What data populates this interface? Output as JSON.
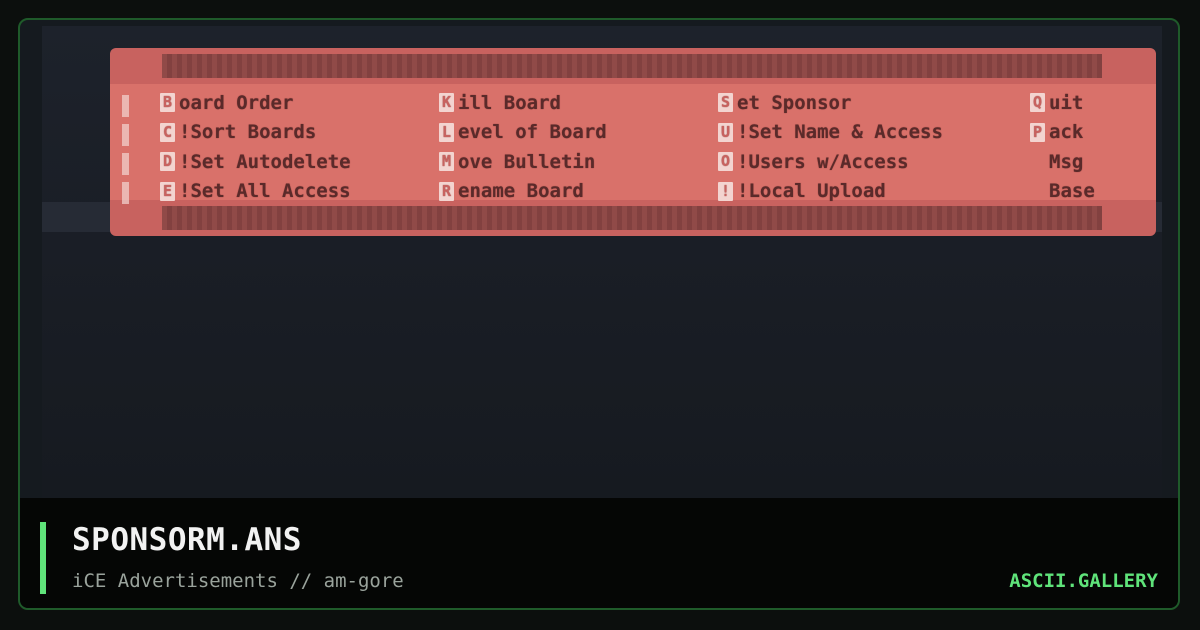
{
  "art": {
    "menu": {
      "columns": [
        {
          "items": [
            {
              "key": "B",
              "label": "oard Order"
            },
            {
              "key": "C",
              "label": "!Sort Boards"
            },
            {
              "key": "D",
              "label": "!Set Autodelete"
            },
            {
              "key": "E",
              "label": "!Set All Access"
            }
          ]
        },
        {
          "items": [
            {
              "key": "K",
              "label": "ill Board"
            },
            {
              "key": "L",
              "label": "evel of Board"
            },
            {
              "key": "M",
              "label": "ove Bulletin"
            },
            {
              "key": "R",
              "label": "ename Board"
            }
          ]
        },
        {
          "items": [
            {
              "key": "S",
              "label": "et Sponsor"
            },
            {
              "key": "U",
              "label": "!Set Name & Access"
            },
            {
              "key": "O",
              "label": "!Users w/Access"
            },
            {
              "key": "!",
              "label": "!Local Upload"
            }
          ]
        },
        {
          "items": [
            {
              "key": "Q",
              "label": "uit"
            },
            {
              "key": "P",
              "label": "ack"
            },
            {
              "key": "",
              "label": "Msg"
            },
            {
              "key": "",
              "label": "Base"
            }
          ]
        }
      ]
    }
  },
  "footer": {
    "title": "SPONSORM.ANS",
    "subtitle": "iCE Advertisements // am-gore",
    "brand": "ASCII.GALLERY"
  },
  "colors": {
    "menu_bg": "#d9716a",
    "menu_text": "#5a2a2a",
    "accent": "#5fe37a",
    "footer_bg": "#050605"
  }
}
